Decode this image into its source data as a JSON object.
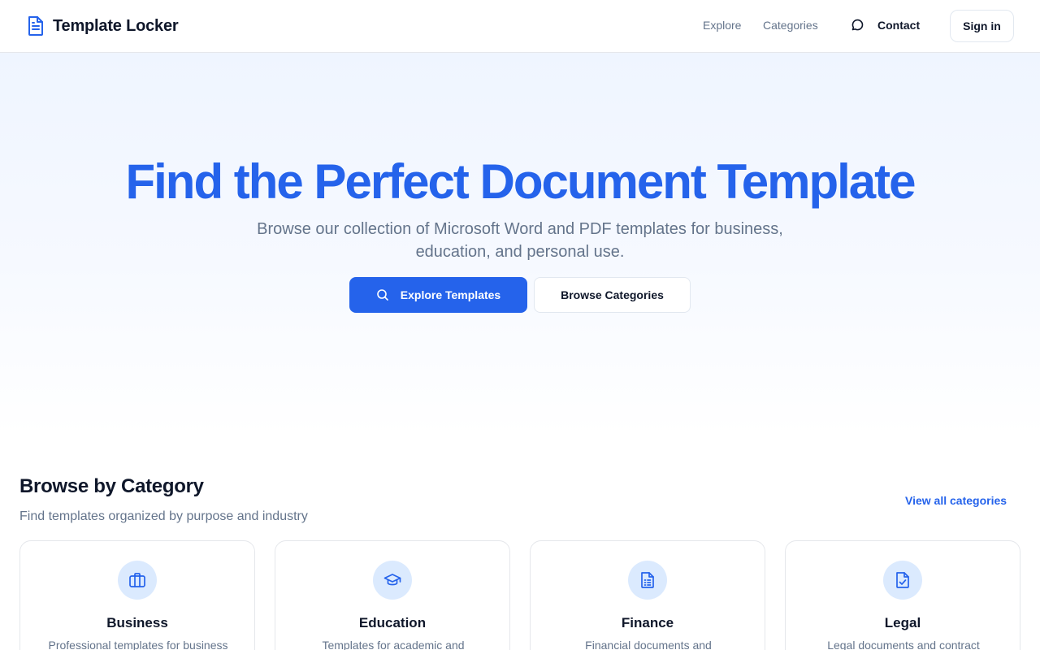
{
  "brand": {
    "name": "Template Locker",
    "icon": "document-icon",
    "accent": "#2563eb"
  },
  "nav": {
    "explore": "Explore",
    "categories": "Categories",
    "contact": "Contact",
    "contact_icon": "chat-bubble-icon",
    "signin": "Sign in"
  },
  "hero": {
    "title": "Find the Perfect Document Template",
    "subtitle": "Browse our collection of Microsoft Word and PDF templates for business, education, and personal use.",
    "primary_button": "Explore Templates",
    "primary_icon": "search-icon",
    "secondary_button": "Browse Categories"
  },
  "categories": {
    "title": "Browse by Category",
    "subtitle": "Find templates organized by purpose and industry",
    "view_all": "View all categories",
    "items": [
      {
        "title": "Business",
        "description": "Professional templates for business",
        "icon": "briefcase-icon"
      },
      {
        "title": "Education",
        "description": "Templates for academic and",
        "icon": "graduation-cap-icon"
      },
      {
        "title": "Finance",
        "description": "Financial documents and",
        "icon": "spreadsheet-document-icon"
      },
      {
        "title": "Legal",
        "description": "Legal documents and contract",
        "icon": "checked-document-icon"
      }
    ]
  }
}
